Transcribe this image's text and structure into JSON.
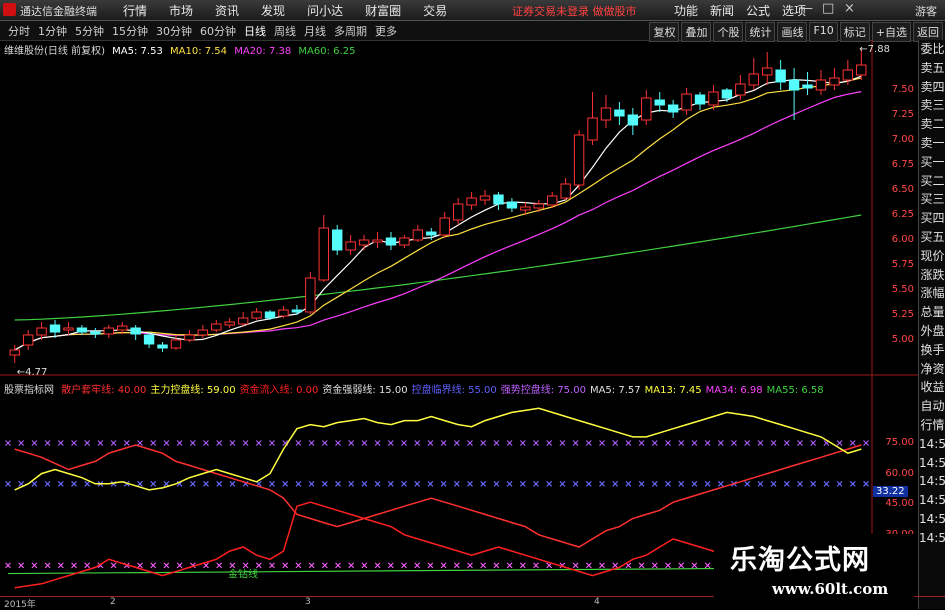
{
  "app": {
    "title": "通达信金融终端"
  },
  "menu": [
    "行情",
    "市场",
    "资讯",
    "发现",
    "问小达",
    "财富圈",
    "交易"
  ],
  "notice": "证券交易未登录  做做股市",
  "right_menu": [
    "功能",
    "新闻",
    "公式",
    "选项"
  ],
  "window": {
    "min": "—",
    "max": "□",
    "close": "×"
  },
  "guest": "游客",
  "periods": [
    "分时",
    "1分钟",
    "5分钟",
    "15分钟",
    "30分钟",
    "60分钟",
    "日线",
    "周线",
    "月线",
    "多周期",
    "更多"
  ],
  "active_period": "日线",
  "tools": [
    "复权",
    "叠加",
    "个股",
    "统计",
    "画线",
    "F10",
    "标记",
    "+自选",
    "返回"
  ],
  "main_legend": {
    "name": "维维股份(日线 前复权)",
    "ma5": "MA5: 7.53",
    "ma10": "MA10: 7.54",
    "ma20": "MA20: 7.38",
    "ma60": "MA60: 6.25",
    "colors": {
      "ma5": "#ffffff",
      "ma10": "#ffe040",
      "ma20": "#ff40ff",
      "ma60": "#40d040"
    }
  },
  "sub_legend": {
    "name": "股票指标网",
    "items": [
      {
        "label": "散户套牢线:",
        "value": "40.00",
        "color": "#ff3030"
      },
      {
        "label": "主力控盘线:",
        "value": "59.00",
        "color": "#ffff40"
      },
      {
        "label": "资金流入线:",
        "value": "0.00",
        "color": "#ff2020"
      },
      {
        "label": "资金强弱线:",
        "value": "15.00",
        "color": "#e0e0e0"
      },
      {
        "label": "控盘临界线:",
        "value": "55.00",
        "color": "#6060ff"
      },
      {
        "label": "强势控盘线:",
        "value": "75.00",
        "color": "#c060ff"
      },
      {
        "label": "MA5:",
        "value": "7.57",
        "color": "#e0e0e0"
      },
      {
        "label": "MA13:",
        "value": "7.45",
        "color": "#ffff40"
      },
      {
        "label": "MA34:",
        "value": "6.98",
        "color": "#ff40ff"
      },
      {
        "label": "MA55:",
        "value": "6.58",
        "color": "#40d040"
      }
    ]
  },
  "price_axis": [
    "7.50",
    "7.25",
    "7.00",
    "6.75",
    "6.50",
    "6.25",
    "6.00",
    "5.75",
    "5.50",
    "5.25",
    "5.00"
  ],
  "sub_axis": [
    "75.00",
    "60.00",
    "45.00",
    "30.00"
  ],
  "badge": "33.22",
  "right_panel": [
    "委比",
    "卖五",
    "卖四",
    "卖三",
    "卖二",
    "卖一",
    "买一",
    "买二",
    "买三",
    "买四",
    "买五",
    "现价",
    "涨跌",
    "涨幅",
    "总量",
    "外盘",
    "换手",
    "净资",
    "收益",
    "自动",
    "行情",
    "14:5",
    "14:5",
    "14:5",
    "14:5",
    "14:5",
    "14:5"
  ],
  "price_labels": {
    "high": "7.88",
    "low": "4.77"
  },
  "annotation": "金钻线",
  "time_labels": [
    "2015年",
    "2",
    "3",
    "4"
  ],
  "watermark": {
    "line1": "乐淘公式网",
    "line2": "www.60lt.com"
  },
  "chart_data": {
    "type": "candlestick",
    "open": [
      4.85,
      4.95,
      5.05,
      5.15,
      5.1,
      5.12,
      5.08,
      5.06,
      5.1,
      5.12,
      5.05,
      4.95,
      4.92,
      5.0,
      5.05,
      5.1,
      5.15,
      5.16,
      5.22,
      5.28,
      5.24,
      5.3,
      5.28,
      5.6,
      6.1,
      5.9,
      5.95,
      5.98,
      6.02,
      5.95,
      6.0,
      6.08,
      6.05,
      6.2,
      6.35,
      6.4,
      6.45,
      6.38,
      6.3,
      6.32,
      6.35,
      6.42,
      6.55,
      7.0,
      7.2,
      7.3,
      7.25,
      7.2,
      7.4,
      7.35,
      7.3,
      7.45,
      7.35,
      7.5,
      7.45,
      7.55,
      7.65,
      7.7,
      7.6,
      7.55,
      7.5,
      7.55,
      7.6,
      7.65
    ],
    "close": [
      4.9,
      5.05,
      5.12,
      5.08,
      5.12,
      5.08,
      5.06,
      5.12,
      5.14,
      5.06,
      4.96,
      4.92,
      5.0,
      5.05,
      5.1,
      5.16,
      5.18,
      5.22,
      5.28,
      5.22,
      5.3,
      5.28,
      5.62,
      6.12,
      5.9,
      5.98,
      6.0,
      6.0,
      5.95,
      6.02,
      6.1,
      6.05,
      6.22,
      6.36,
      6.42,
      6.44,
      6.36,
      6.32,
      6.33,
      6.36,
      6.44,
      6.56,
      7.05,
      7.22,
      7.32,
      7.24,
      7.15,
      7.42,
      7.35,
      7.28,
      7.46,
      7.36,
      7.48,
      7.42,
      7.56,
      7.66,
      7.72,
      7.58,
      7.5,
      7.52,
      7.6,
      7.62,
      7.7,
      7.75
    ],
    "high": [
      4.95,
      5.1,
      5.18,
      5.2,
      5.18,
      5.15,
      5.12,
      5.15,
      5.18,
      5.15,
      5.08,
      4.98,
      5.05,
      5.1,
      5.15,
      5.2,
      5.22,
      5.28,
      5.32,
      5.3,
      5.34,
      5.35,
      5.68,
      6.25,
      6.15,
      6.05,
      6.05,
      6.08,
      6.08,
      6.05,
      6.15,
      6.12,
      6.28,
      6.42,
      6.48,
      6.5,
      6.48,
      6.42,
      6.38,
      6.4,
      6.48,
      6.62,
      7.1,
      7.48,
      7.45,
      7.38,
      7.32,
      7.5,
      7.48,
      7.4,
      7.52,
      7.48,
      7.55,
      7.52,
      7.65,
      7.82,
      7.88,
      7.8,
      7.72,
      7.68,
      7.7,
      7.72,
      7.8,
      7.9
    ],
    "low": [
      4.77,
      4.9,
      5.0,
      5.02,
      5.05,
      5.05,
      5.02,
      5.02,
      5.06,
      5.0,
      4.92,
      4.88,
      4.9,
      4.98,
      5.02,
      5.08,
      5.12,
      5.14,
      5.2,
      5.2,
      5.22,
      5.25,
      5.26,
      5.58,
      5.85,
      5.85,
      5.9,
      5.92,
      5.9,
      5.92,
      5.98,
      6.0,
      6.02,
      6.15,
      6.3,
      6.35,
      6.3,
      6.28,
      6.25,
      6.28,
      6.32,
      6.4,
      6.5,
      6.95,
      7.12,
      7.15,
      7.05,
      7.15,
      7.28,
      7.22,
      7.25,
      7.3,
      7.3,
      7.38,
      7.4,
      7.5,
      7.55,
      7.5,
      7.2,
      7.45,
      7.45,
      7.5,
      7.55,
      7.6
    ],
    "ylim": [
      4.7,
      8.0
    ],
    "sub_chart": {
      "ylim": [
        0,
        100
      ],
      "levels": {
        "strong": 75,
        "critical": 55,
        "retail": 40,
        "base": 15
      },
      "main_control": [
        52,
        55,
        60,
        62,
        60,
        58,
        55,
        55,
        56,
        54,
        52,
        53,
        55,
        58,
        60,
        62,
        60,
        58,
        56,
        60,
        72,
        82,
        84,
        83,
        85,
        86,
        87,
        85,
        84,
        86,
        86,
        88,
        86,
        84,
        83,
        86,
        88,
        90,
        91,
        92,
        90,
        88,
        86,
        84,
        82,
        80,
        78,
        78,
        80,
        82,
        84,
        86,
        88,
        90,
        89,
        88,
        86,
        84,
        82,
        80,
        78,
        74,
        70,
        72
      ],
      "retail_trap": [
        72,
        70,
        68,
        65,
        62,
        64,
        66,
        70,
        72,
        74,
        72,
        70,
        66,
        64,
        62,
        60,
        58,
        56,
        54,
        52,
        48,
        40,
        38,
        36,
        34,
        36,
        38,
        40,
        42,
        44,
        46,
        48,
        46,
        44,
        42,
        40,
        38,
        36,
        34,
        30,
        28,
        26,
        24,
        28,
        32,
        34,
        38,
        40,
        42,
        46,
        48,
        50,
        52,
        54,
        56,
        58,
        60,
        62,
        64,
        66,
        68,
        70,
        72,
        74
      ],
      "fund_inflow": [
        4,
        5,
        6,
        8,
        10,
        12,
        14,
        18,
        16,
        14,
        12,
        10,
        12,
        14,
        16,
        18,
        22,
        24,
        20,
        18,
        22,
        44,
        46,
        44,
        42,
        40,
        38,
        36,
        34,
        30,
        28,
        26,
        24,
        22,
        20,
        22,
        24,
        22,
        20,
        18,
        16,
        14,
        12,
        10,
        12,
        14,
        18,
        20,
        24,
        28,
        26,
        24,
        22,
        20,
        18,
        16,
        14,
        12,
        10,
        8,
        6,
        4,
        2,
        0
      ]
    }
  }
}
